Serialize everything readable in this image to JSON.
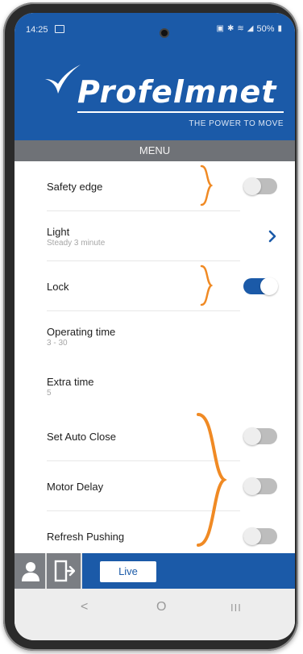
{
  "status_bar": {
    "time": "14:25",
    "battery": "50%"
  },
  "brand": {
    "name": "Profelmnet",
    "tagline": "THE POWER TO MOVE"
  },
  "menu": {
    "title": "MENU"
  },
  "settings": [
    {
      "label": "Safety edge",
      "type": "toggle",
      "state": "off"
    },
    {
      "label": "Light",
      "sub": "Steady 3 minute",
      "type": "chevron"
    },
    {
      "label": "Lock",
      "type": "toggle",
      "state": "on"
    },
    {
      "label": "Operating time",
      "sub": "3 - 30",
      "type": "value"
    },
    {
      "label": "Extra time",
      "sub": "5",
      "type": "value"
    },
    {
      "label": "Set Auto Close",
      "type": "toggle",
      "state": "off"
    },
    {
      "label": "Motor Delay",
      "type": "toggle",
      "state": "off"
    },
    {
      "label": "Refresh Pushing",
      "type": "toggle",
      "state": "off"
    }
  ],
  "toolbar": {
    "live_label": "Live",
    "user_icon": "user-icon",
    "exit_icon": "exit-door-icon"
  },
  "navigation": {
    "back": "<",
    "home": "O",
    "recents": "III"
  },
  "colors": {
    "brand_blue": "#1b5aa8",
    "menu_gray": "#6f7277",
    "annotation_orange": "#f08a24"
  }
}
